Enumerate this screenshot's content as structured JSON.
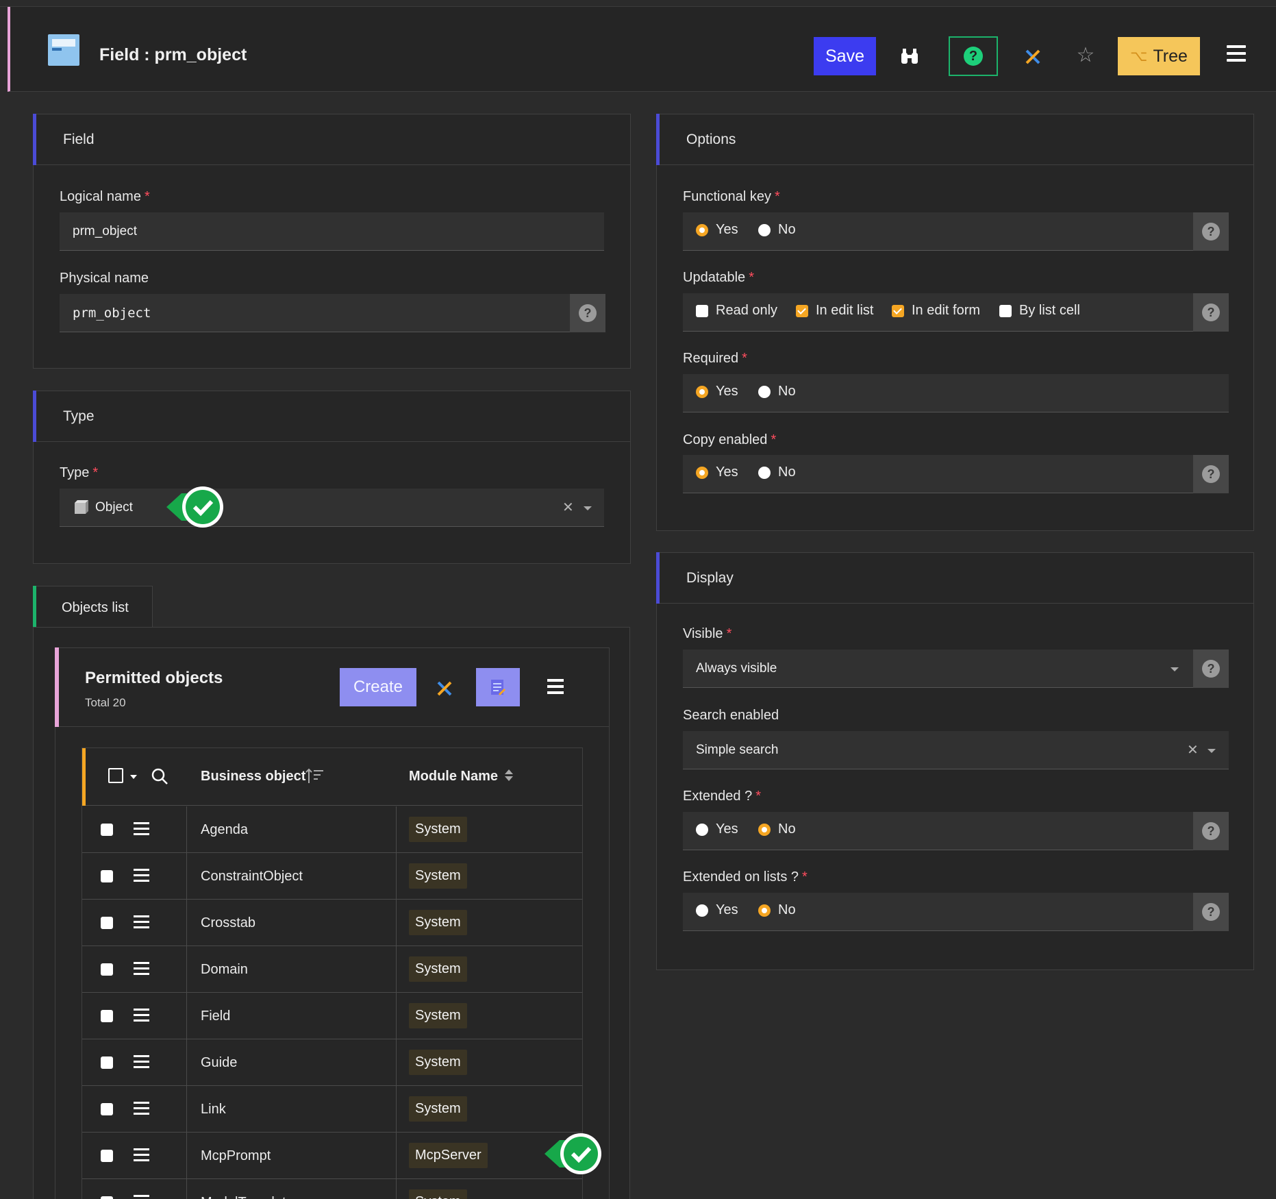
{
  "header": {
    "title": "Field : prm_object",
    "save_label": "Save",
    "tree_label": "Tree",
    "icons": [
      "app-icon",
      "binoculars-icon",
      "help-icon",
      "cross-icon",
      "star-icon",
      "tree-icon",
      "menu-icon"
    ]
  },
  "field_panel": {
    "title": "Field",
    "logical_name_label": "Logical name",
    "logical_name_value": "prm_object",
    "physical_name_label": "Physical name",
    "physical_name_value": "prm_object"
  },
  "type_panel": {
    "title": "Type",
    "type_label": "Type",
    "type_value": "Object"
  },
  "options_panel": {
    "title": "Options",
    "functional_key": {
      "label": "Functional key",
      "yes": "Yes",
      "no": "No",
      "selected": "Yes"
    },
    "updatable": {
      "label": "Updatable",
      "options": [
        {
          "label": "Read only",
          "checked": false
        },
        {
          "label": "In edit list",
          "checked": true
        },
        {
          "label": "In edit form",
          "checked": true
        },
        {
          "label": "By list cell",
          "checked": false
        }
      ]
    },
    "required": {
      "label": "Required",
      "yes": "Yes",
      "no": "No",
      "selected": "Yes"
    },
    "copy_enabled": {
      "label": "Copy enabled",
      "yes": "Yes",
      "no": "No",
      "selected": "Yes"
    }
  },
  "display_panel": {
    "title": "Display",
    "visible": {
      "label": "Visible",
      "value": "Always visible"
    },
    "search_enabled": {
      "label": "Search enabled",
      "value": "Simple search"
    },
    "extended": {
      "label": "Extended ?",
      "yes": "Yes",
      "no": "No",
      "selected": "No"
    },
    "extended_on_lists": {
      "label": "Extended on lists ?",
      "yes": "Yes",
      "no": "No",
      "selected": "No"
    }
  },
  "objects_tab": {
    "label": "Objects list",
    "permitted": {
      "title": "Permitted objects",
      "total": "Total 20",
      "create_label": "Create"
    },
    "grid": {
      "col_business_object": "Business object",
      "col_module_name": "Module Name",
      "rows": [
        {
          "name": "Agenda",
          "module": "System"
        },
        {
          "name": "ConstraintObject",
          "module": "System"
        },
        {
          "name": "Crosstab",
          "module": "System"
        },
        {
          "name": "Domain",
          "module": "System"
        },
        {
          "name": "Field",
          "module": "System"
        },
        {
          "name": "Guide",
          "module": "System"
        },
        {
          "name": "Link",
          "module": "System"
        },
        {
          "name": "McpPrompt",
          "module": "McpServer"
        },
        {
          "name": "ModelTemplate",
          "module": "System"
        }
      ]
    }
  },
  "colors": {
    "accent_blue": "#3c3cf0",
    "tree_yellow": "#f5c65a",
    "radio_orange": "#f5a623",
    "required_red": "#ff4d5e",
    "success_green": "#1cb36b"
  }
}
